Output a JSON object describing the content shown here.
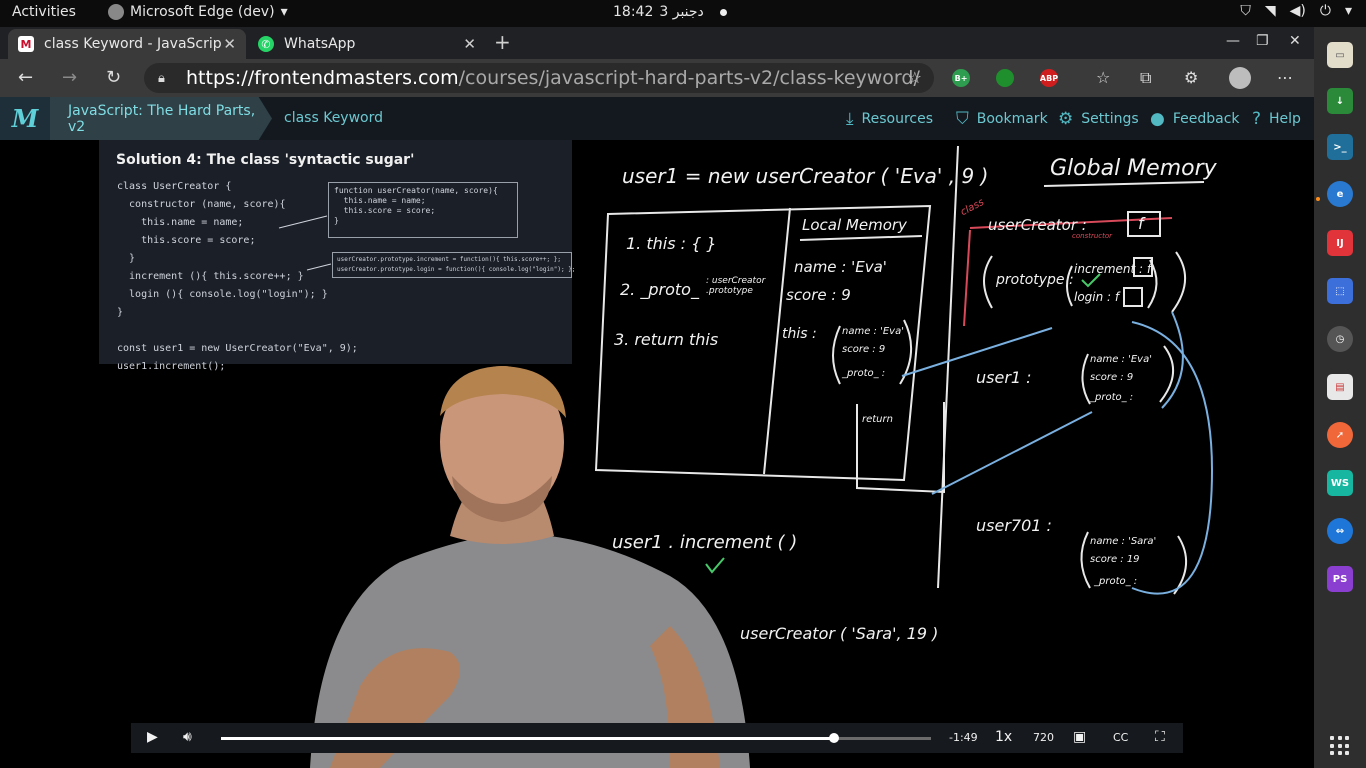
{
  "system": {
    "activities": "Activities",
    "app_name": "Microsoft Edge (dev)",
    "time": "18:42",
    "date": "3 دجنبر"
  },
  "tabs": [
    {
      "title": "class Keyword - JavaScrip",
      "icon": "frontend-masters-icon",
      "active": true
    },
    {
      "title": "WhatsApp",
      "icon": "whatsapp-icon",
      "active": false
    }
  ],
  "url": {
    "host": "https://frontendmasters.com",
    "path": "/courses/javascript-hard-parts-v2/class-keyword/"
  },
  "extensions": [
    {
      "label": "B+",
      "color": "#2e9d4f"
    },
    {
      "label": "",
      "color": "#1f8f2e"
    },
    {
      "label": "ABP",
      "color": "#d01e1e"
    }
  ],
  "fm": {
    "course": "JavaScript: The Hard Parts, v2",
    "lesson": "class Keyword",
    "nav": {
      "resources": "Resources",
      "bookmark": "Bookmark",
      "settings": "Settings",
      "feedback": "Feedback",
      "help": "Help"
    }
  },
  "slide": {
    "title": "Solution 4: The class 'syntactic sugar'",
    "code": "class UserCreator {\n  constructor (name, score){\n    this.name = name;\n    this.score = score;\n  }\n  increment (){ this.score++; }\n  login (){ console.log(\"login\"); }\n}\n\nconst user1 = new UserCreator(\"Eva\", 9);\nuser1.increment();",
    "box1": "function userCreator(name, score){\n  this.name = name;\n  this.score = score;\n}",
    "box2": "userCreator.prototype.increment = function(){ this.score++; };\nuserCreator.prototype.login = function(){ console.log(\"login\"); };"
  },
  "board": {
    "user1_call": "user1  = new userCreator ( 'Eva' ,  9 )",
    "global_memory": "Global Memory",
    "local_memory": "Local Memory",
    "step1": "1. this : {   }",
    "step2": "2. _proto_",
    "step2_note": ": userCreator .prototype",
    "step3": "3. return  this",
    "name_eva": "name : 'Eva'",
    "score_9": "score  :   9",
    "this_label": "this :",
    "this_obj": [
      "name : 'Eva'",
      "score : 9",
      "_proto_ :"
    ],
    "return_label": "return",
    "class_label": "class",
    "usercreator": "userCreator :",
    "constructor_label": "constructor",
    "f_label": "f",
    "prototype": "prototype :",
    "proto_obj": [
      "increment : f",
      "login : f"
    ],
    "user1_label": "user1  :",
    "user1_obj": [
      "name : 'Eva'",
      "score : 9",
      "_proto_ :"
    ],
    "user701_label": "user701  :",
    "user701_obj": [
      "name : 'Sara'",
      "score : 19",
      "_proto_ :"
    ],
    "increment_call": "user1 . increment (  )",
    "sara_call": "userCreator ( 'Sara',  19 )"
  },
  "player": {
    "time_remaining": "-1:49",
    "speed": "1x",
    "quality": "720",
    "progress": 0.863
  }
}
